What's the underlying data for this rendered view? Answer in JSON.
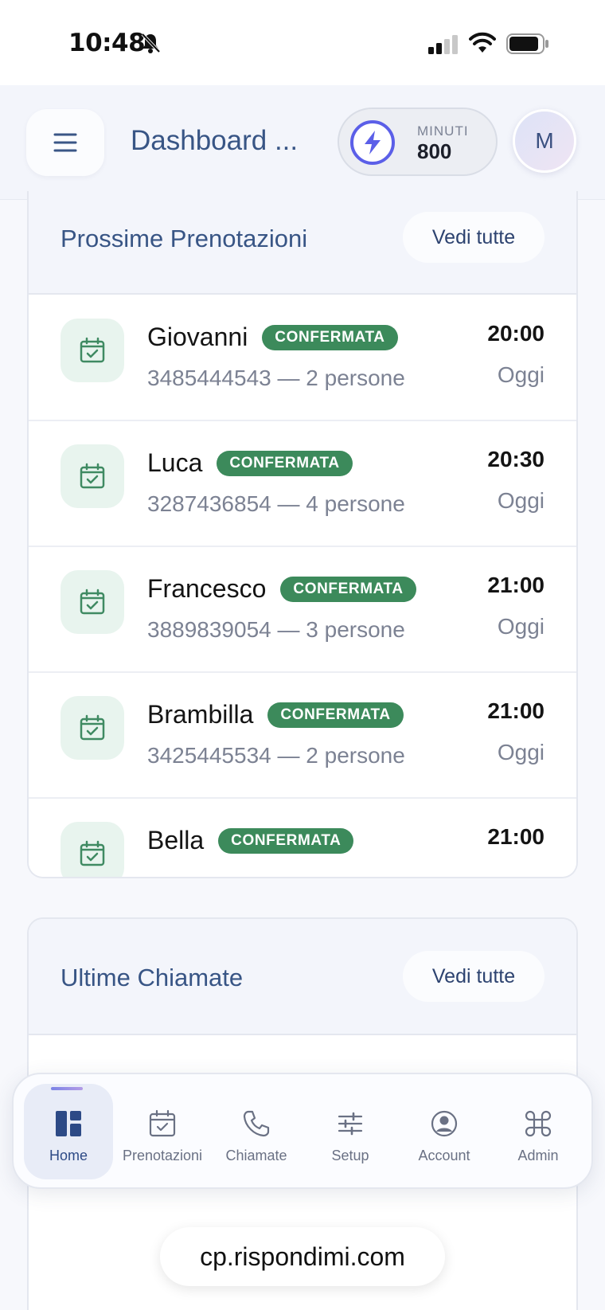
{
  "status_bar": {
    "time": "10:48"
  },
  "header": {
    "menu_icon": "hamburger-icon",
    "title": "Dashboard ...",
    "minutes_label": "MINUTI",
    "minutes_value": "800",
    "avatar_initial": "M"
  },
  "bookings_card": {
    "title": "Prossime Prenotazioni",
    "see_all": "Vedi tutte",
    "items": [
      {
        "name": "Giovanni",
        "status": "CONFERMATA",
        "detail": "3485444543 — 2 persone",
        "time": "20:00",
        "day": "Oggi"
      },
      {
        "name": "Luca",
        "status": "CONFERMATA",
        "detail": "3287436854 — 4 persone",
        "time": "20:30",
        "day": "Oggi"
      },
      {
        "name": "Francesco",
        "status": "CONFERMATA",
        "detail": "3889839054 — 3 persone",
        "time": "21:00",
        "day": "Oggi"
      },
      {
        "name": "Brambilla",
        "status": "CONFERMATA",
        "detail": "3425445534 — 2 persone",
        "time": "21:00",
        "day": "Oggi"
      },
      {
        "name": "Bella",
        "status": "CONFERMATA",
        "detail": "",
        "time": "21:00",
        "day": ""
      }
    ]
  },
  "calls_card": {
    "title": "Ultime Chiamate",
    "see_all": "Vedi tutte"
  },
  "bottom_nav": {
    "items": [
      {
        "label": "Home",
        "icon": "dashboard-icon",
        "active": true
      },
      {
        "label": "Prenotazioni",
        "icon": "calendar-check-icon",
        "active": false
      },
      {
        "label": "Chiamate",
        "icon": "phone-icon",
        "active": false
      },
      {
        "label": "Setup",
        "icon": "sliders-icon",
        "active": false
      },
      {
        "label": "Account",
        "icon": "user-circle-icon",
        "active": false
      },
      {
        "label": "Admin",
        "icon": "command-icon",
        "active": false
      }
    ]
  },
  "browser": {
    "url": "cp.rispondimi.com"
  },
  "colors": {
    "accent": "#385585",
    "badge_green": "#3c8a5b",
    "bolt_purple": "#5b5fe8"
  }
}
